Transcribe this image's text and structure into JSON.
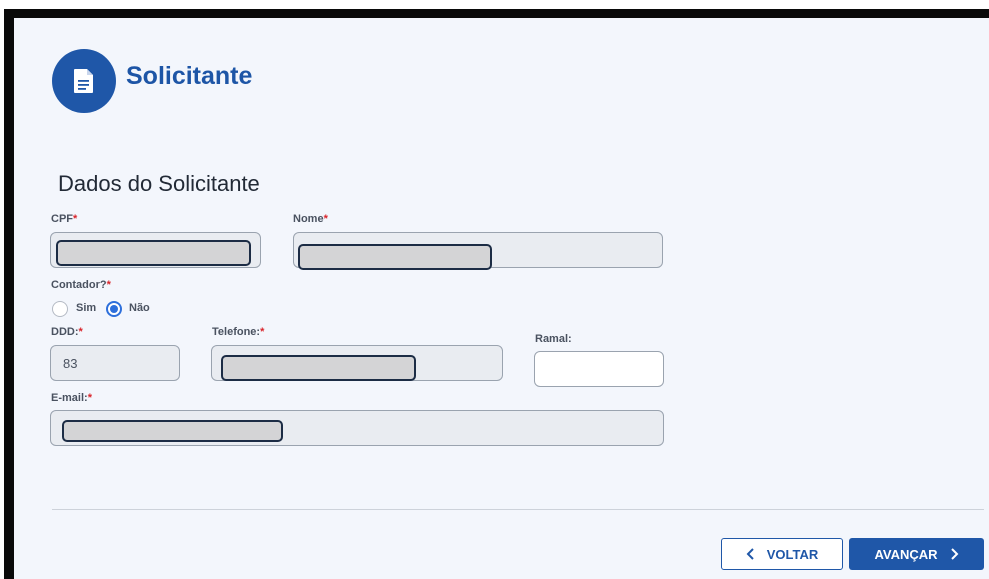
{
  "header": {
    "title": "Solicitante",
    "icon": "document-icon"
  },
  "section": {
    "title": "Dados do Solicitante"
  },
  "fields": {
    "cpf": {
      "label": "CPF",
      "required_mark": "*",
      "value": ""
    },
    "nome": {
      "label": "Nome",
      "required_mark": "*",
      "value": ""
    },
    "contador": {
      "label": "Contador?",
      "required_mark": "*",
      "options": [
        "Sim",
        "Não"
      ],
      "selected": "Não"
    },
    "ddd": {
      "label": "DDD:",
      "required_mark": "*",
      "value": "83"
    },
    "telefone": {
      "label": "Telefone:",
      "required_mark": "*",
      "value": ""
    },
    "ramal": {
      "label": "Ramal:",
      "value": ""
    },
    "email": {
      "label": "E-mail:",
      "required_mark": "*",
      "value": ""
    }
  },
  "buttons": {
    "back": {
      "label": "VOLTAR",
      "icon": "chevron-left-icon"
    },
    "next": {
      "label": "AVANÇAR",
      "icon": "chevron-right-icon"
    }
  },
  "colors": {
    "primary": "#1f57a8",
    "required": "#d9252b",
    "radio_selected": "#2d6fdb"
  }
}
